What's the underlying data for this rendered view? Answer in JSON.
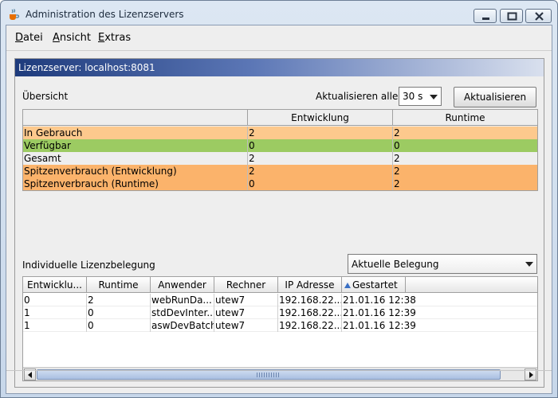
{
  "window": {
    "title": "Administration des Lizenzservers"
  },
  "menu": [
    "Datei",
    "Ansicht",
    "Extras"
  ],
  "panel": {
    "header": "Lizenzserver: localhost:8081"
  },
  "overview": {
    "label": "Übersicht",
    "refresh_label": "Aktualisieren alle",
    "interval_value": "30 s",
    "refresh_button": "Aktualisieren",
    "columns": [
      "",
      "Entwicklung",
      "Runtime"
    ],
    "rows": [
      {
        "label": "In Gebrauch",
        "entwicklung": "2",
        "runtime": "2",
        "color": "#fdc98d"
      },
      {
        "label": "Verfügbar",
        "entwicklung": "0",
        "runtime": "0",
        "color": "#9ccb62"
      },
      {
        "label": "Gesamt",
        "entwicklung": "2",
        "runtime": "2",
        "color": "#eeeeee"
      },
      {
        "label": "Spitzenverbrauch (Entwicklung)",
        "entwicklung": "2",
        "runtime": "2",
        "color": "#fbb36b"
      },
      {
        "label": "Spitzenverbrauch (Runtime)",
        "entwicklung": "0",
        "runtime": "2",
        "color": "#fbb36b"
      }
    ]
  },
  "individual": {
    "label": "Individuelle Lizenzbelegung",
    "view_select": "Aktuelle Belegung",
    "columns": [
      "Entwicklu...",
      "Runtime",
      "Anwender",
      "Rechner",
      "IP Adresse",
      "Gestartet"
    ],
    "rows": [
      [
        "0",
        "2",
        "webRunDa...",
        "utew7",
        "192.168.22....",
        "21.01.16 12:38"
      ],
      [
        "1",
        "0",
        "stdDevInter...",
        "utew7",
        "192.168.22....",
        "21.01.16 12:39"
      ],
      [
        "1",
        "0",
        "aswDevBatch",
        "utew7",
        "192.168.22....",
        "21.01.16 12:39"
      ]
    ]
  }
}
